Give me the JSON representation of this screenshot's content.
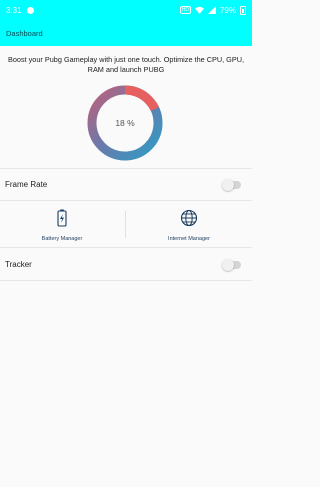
{
  "status_bar": {
    "time": "3:31",
    "hd_label": "HD",
    "battery_percent": "79%"
  },
  "app_bar": {
    "title": "Dashboard"
  },
  "description": "Boost your Pubg Gameplay with just one touch. Optimize the CPU, GPU, RAM and launch PUBG",
  "gauge": {
    "label": "18 %",
    "value": 0.18,
    "colors": {
      "accent": "#e5605f",
      "primary": "#2e9cc6",
      "secondary": "#8a6a98"
    }
  },
  "frame_rate": {
    "label": "Frame Rate",
    "enabled": false
  },
  "tiles": {
    "battery": {
      "label": "Battery Manager",
      "icon": "battery-charging-icon"
    },
    "internet": {
      "label": "Internet Manager",
      "icon": "globe-icon"
    }
  },
  "tracker": {
    "label": "Tracker",
    "enabled": false
  },
  "colors": {
    "app_bar": "#00ffff",
    "tile_text": "#1a3c5e"
  }
}
